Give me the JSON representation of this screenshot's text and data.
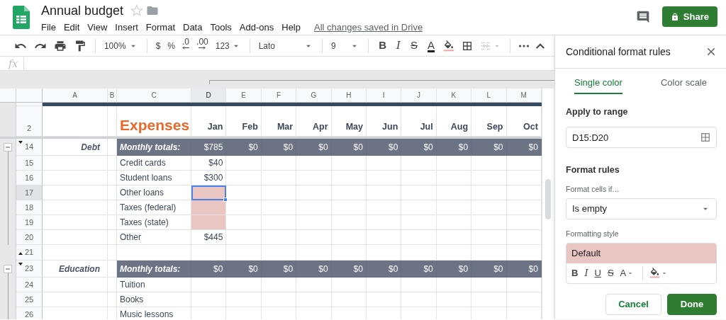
{
  "document": {
    "title": "Annual budget",
    "starred": false
  },
  "menu": [
    "File",
    "Edit",
    "View",
    "Insert",
    "Format",
    "Data",
    "Tools",
    "Add-ons",
    "Help"
  ],
  "save_status": "All changes saved in Drive",
  "share_button": "Share",
  "toolbar": {
    "zoom": "100%",
    "currency": "$",
    "percent": "%",
    "decrease_decimals": ".0",
    "increase_decimals": ".00",
    "more_formats": "123",
    "font": "Lato",
    "font_size": "9",
    "text_styles": [
      "B",
      "I",
      "S",
      "A"
    ]
  },
  "formula_bar": {
    "label": "fx"
  },
  "sheet": {
    "columns": [
      {
        "label": "A",
        "selected": false
      },
      {
        "label": "B",
        "selected": false
      },
      {
        "label": "C",
        "selected": false
      },
      {
        "label": "D",
        "selected": true
      },
      {
        "label": "E",
        "selected": false
      },
      {
        "label": "F",
        "selected": false
      },
      {
        "label": "G",
        "selected": false
      },
      {
        "label": "H",
        "selected": false
      },
      {
        "label": "I",
        "selected": false
      },
      {
        "label": "J",
        "selected": false
      },
      {
        "label": "K",
        "selected": false
      },
      {
        "label": "L",
        "selected": false
      },
      {
        "label": "M",
        "selected": false
      }
    ],
    "rows": [
      {
        "kind": "banner"
      },
      {
        "kind": "heading",
        "number": "2",
        "title": "Expenses",
        "months": [
          "Jan",
          "Feb",
          "Mar",
          "Apr",
          "May",
          "Jun",
          "Jul",
          "Aug",
          "Sep",
          "Oct"
        ]
      },
      {
        "kind": "total",
        "number": "14",
        "category": "Debt",
        "label": "Monthly totals:",
        "values": [
          "$785",
          "$0",
          "$0",
          "$0",
          "$0",
          "$0",
          "$0",
          "$0",
          "$0",
          "$0"
        ],
        "expanded": true,
        "children": [
          {
            "kind": "item",
            "number": "15",
            "label": "Credit cards",
            "values": [
              "$40"
            ],
            "highlighted": false,
            "selected": false
          },
          {
            "kind": "item",
            "number": "16",
            "label": "Student loans",
            "values": [
              "$300"
            ],
            "highlighted": false,
            "selected": false
          },
          {
            "kind": "item",
            "number": "17",
            "label": "Other loans",
            "highlighted": true,
            "selected": true
          },
          {
            "kind": "item",
            "number": "18",
            "label": "Taxes (federal)",
            "highlighted": true,
            "selected": false
          },
          {
            "kind": "item",
            "number": "19",
            "label": "Taxes (state)",
            "highlighted": true,
            "selected": false
          },
          {
            "kind": "item",
            "number": "20",
            "label": "Other",
            "values": [
              "$445"
            ],
            "highlighted": false,
            "selected": false
          }
        ]
      },
      {
        "kind": "blank",
        "number": "21"
      },
      {
        "kind": "total",
        "number": "23",
        "category": "Education",
        "label": "Monthly totals:",
        "values": [
          "$0",
          "$0",
          "$0",
          "$0",
          "$0",
          "$0",
          "$0",
          "$0",
          "$0",
          "$0"
        ],
        "expanded": true,
        "children": [
          {
            "kind": "item",
            "number": "24",
            "label": "Tuition",
            "highlighted": false,
            "selected": false
          },
          {
            "kind": "item",
            "number": "25",
            "label": "Books",
            "highlighted": false,
            "selected": false
          },
          {
            "kind": "item",
            "number": "26",
            "label": "Music lessons",
            "highlighted": false,
            "selected": false
          }
        ]
      }
    ]
  },
  "panel": {
    "title": "Conditional format rules",
    "tabs": [
      {
        "label": "Single color",
        "selected": true
      },
      {
        "label": "Color scale",
        "selected": false
      }
    ],
    "range_label": "Apply to range",
    "range_value": "D15:D20",
    "rules_heading": "Format rules",
    "condition_label": "Format cells if…",
    "condition_value": "Is empty",
    "style_label": "Formatting style",
    "style_preview": "Default",
    "style_buttons": [
      "B",
      "I",
      "U",
      "S",
      "A"
    ],
    "buttons": [
      {
        "label": "Cancel",
        "kind": "secondary"
      },
      {
        "label": "Done",
        "kind": "primary"
      }
    ]
  }
}
